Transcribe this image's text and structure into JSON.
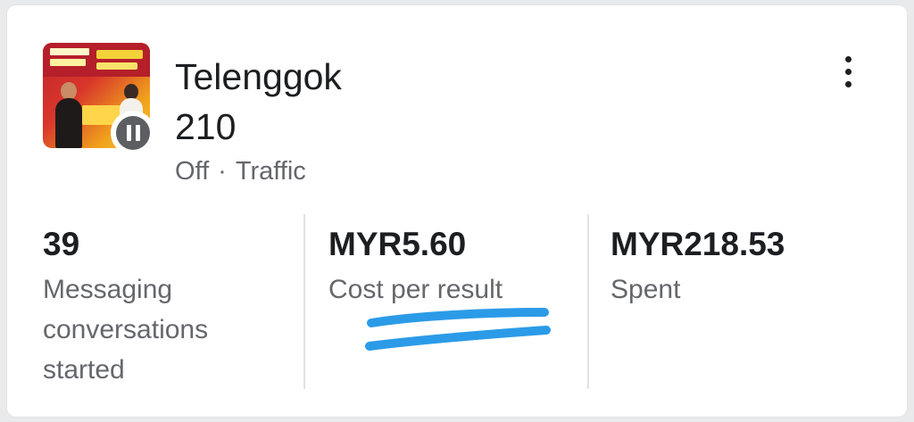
{
  "campaign": {
    "name": "Telenggok\n210",
    "status": "Off",
    "separator": "·",
    "objective": "Traffic",
    "thumbnail_description": "ad-creative-thumbnail",
    "status_icon": "pause-icon"
  },
  "menu": {
    "icon": "more-vertical-icon"
  },
  "metrics": [
    {
      "value": "39",
      "label": "Messaging conversations started"
    },
    {
      "value": "MYR5.60",
      "label": "Cost per result"
    },
    {
      "value": "MYR218.53",
      "label": "Spent"
    }
  ],
  "colors": {
    "text_primary": "#1c1e21",
    "text_secondary": "#65676b",
    "highlight_scribble": "#2b9be8",
    "pause_badge": "#5c5e62"
  }
}
